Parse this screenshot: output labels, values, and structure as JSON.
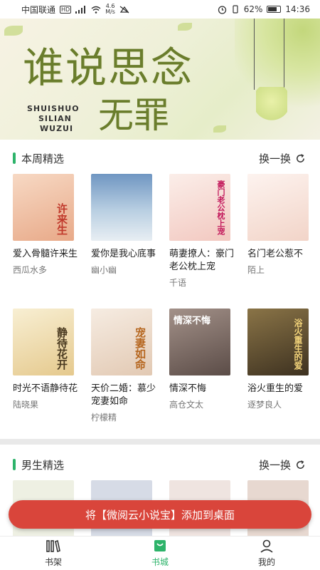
{
  "status_bar": {
    "carrier": "中国联通",
    "network": "HD",
    "speed_top": "4.6",
    "speed_bottom": "M/s",
    "battery": "62%",
    "time": "14:36",
    "battery_level": 0.62
  },
  "banner": {
    "title_line1": "谁说思念",
    "title_line2": "无罪",
    "pinyin": [
      "SHUISHUO",
      "SILIAN",
      "WUZUI"
    ]
  },
  "weekly": {
    "title": "本周精选",
    "refresh": "换一换",
    "books": [
      {
        "title": "爱入骨髓许来生",
        "author": "西瓜水多",
        "cover_text": "许来生",
        "cover_bg": "#f2c6a6"
      },
      {
        "title": "爱你是我心底事",
        "author": "幽小幽",
        "cover_text": "",
        "cover_bg": "#7fa3c8"
      },
      {
        "title": "萌妻撩人：豪门老公枕上宠",
        "author": "千语",
        "cover_text": "豪门老公枕上宠",
        "cover_bg": "#f6ddd6"
      },
      {
        "title": "名门老公惹不",
        "author": "陌上",
        "cover_text": "",
        "cover_bg": "#f9eae3"
      },
      {
        "title": "时光不语静待花开",
        "author": "陆晓果",
        "cover_text": "静待花开",
        "cover_bg": "#f2e6c8"
      },
      {
        "title": "天价二婚：慕少宠妻如命",
        "author": "柠檬精",
        "cover_text": "宠妻如命",
        "cover_bg": "#efe2d6"
      },
      {
        "title": "情深不悔",
        "author": "高仓文太",
        "cover_text": "情深不悔",
        "cover_bg": "#8f7e78"
      },
      {
        "title": "浴火重生的爱",
        "author": "逐梦良人",
        "cover_text": "浴火重生的爱",
        "cover_bg": "#6b5a3c"
      }
    ]
  },
  "male": {
    "title": "男生精选",
    "refresh": "换一换",
    "covers": [
      "#eef0e3",
      "#d6dbe6",
      "#efe4e0",
      "#e7d8d0"
    ]
  },
  "add_to_desktop": "将【微阅云小说宝】添加到桌面",
  "tabs": [
    {
      "label": "书架",
      "icon": "bookshelf-icon"
    },
    {
      "label": "书城",
      "icon": "store-bag-icon",
      "active": true
    },
    {
      "label": "我的",
      "icon": "user-icon"
    }
  ],
  "colors": {
    "accent": "#2db36a",
    "banner_button": "#d9453b"
  }
}
